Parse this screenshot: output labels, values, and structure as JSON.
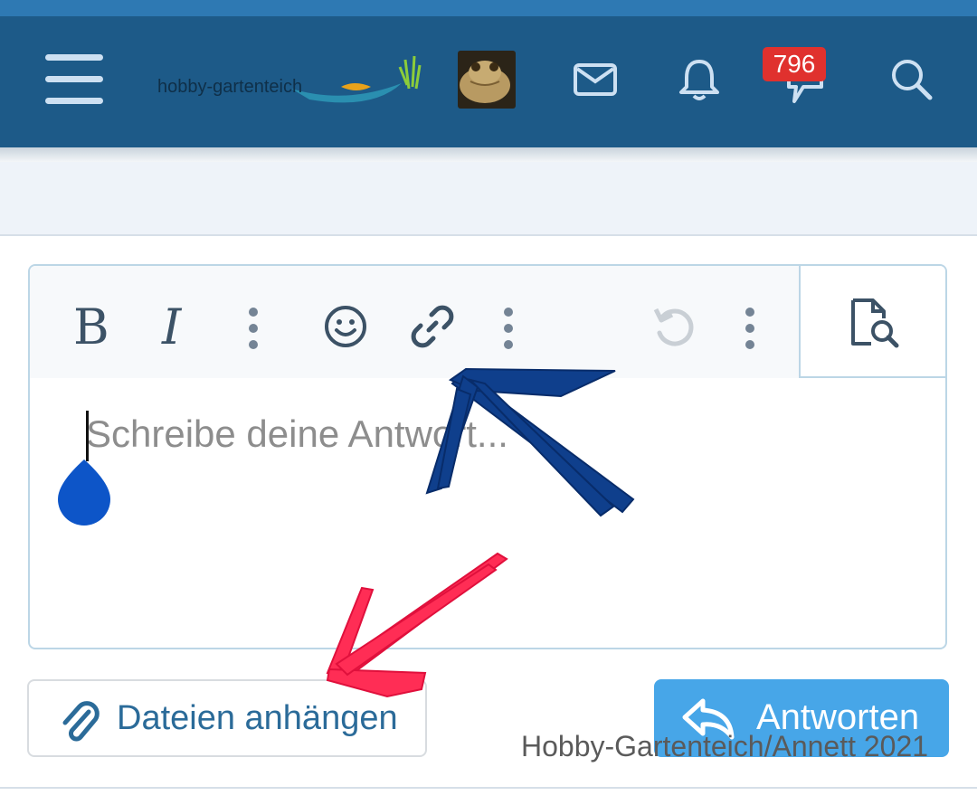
{
  "header": {
    "logo_text": "hobby-gartenteich",
    "notification_badge": "796",
    "icons": [
      "menu-icon",
      "mail-icon",
      "bell-icon",
      "alerts-icon",
      "search-icon"
    ],
    "background": "#1d5a88"
  },
  "editor": {
    "toolbar": {
      "bold_label": "B",
      "italic_label": "I"
    },
    "placeholder": "Schreibe deine Antwort..."
  },
  "actions": {
    "attach_label": "Dateien anhängen",
    "reply_label": "Antworten"
  },
  "watermark": "Hobby-Gartenteich/Annett 2021",
  "colors": {
    "accent": "#47a6e8",
    "badge": "#e0312e",
    "arrow_blue": "#0f3f8c",
    "arrow_red": "#ff2d55"
  }
}
